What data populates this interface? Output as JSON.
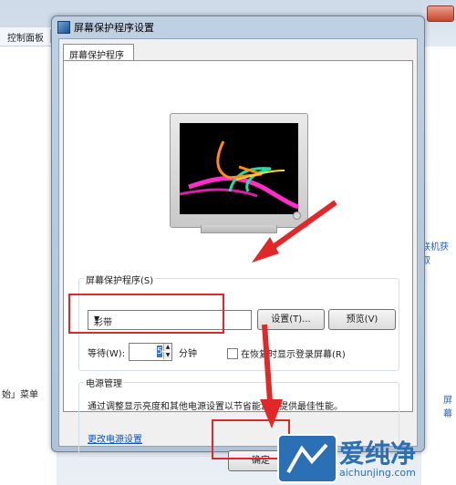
{
  "background": {
    "toolbar_label": "控制面板",
    "left_text": "始」菜单",
    "right_text": "联机获取",
    "right_text2": "屏幕"
  },
  "dialog": {
    "title": "屏幕保护程序设置",
    "tab_label": "屏幕保护程序"
  },
  "screensaver": {
    "group_title": "屏幕保护程序(S)",
    "selected": "彩带",
    "settings_button": "设置(T)...",
    "preview_button": "预览(V)",
    "wait_label": "等待(W):",
    "wait_value": "5",
    "wait_unit": "分钟",
    "resume_checkbox_label": "在恢复时显示登录屏幕(R)"
  },
  "power": {
    "group_title": "电源管理",
    "description": "通过调整显示亮度和其他电源设置以节省能源或提供最佳性能。",
    "link": "更改电源设置"
  },
  "footer": {
    "ok_button": "确定"
  },
  "watermark": {
    "brand": "爱纯净",
    "url": "aichunjing.com"
  },
  "colors": {
    "annotation": "#e02828",
    "accent": "#2b6fb5"
  }
}
